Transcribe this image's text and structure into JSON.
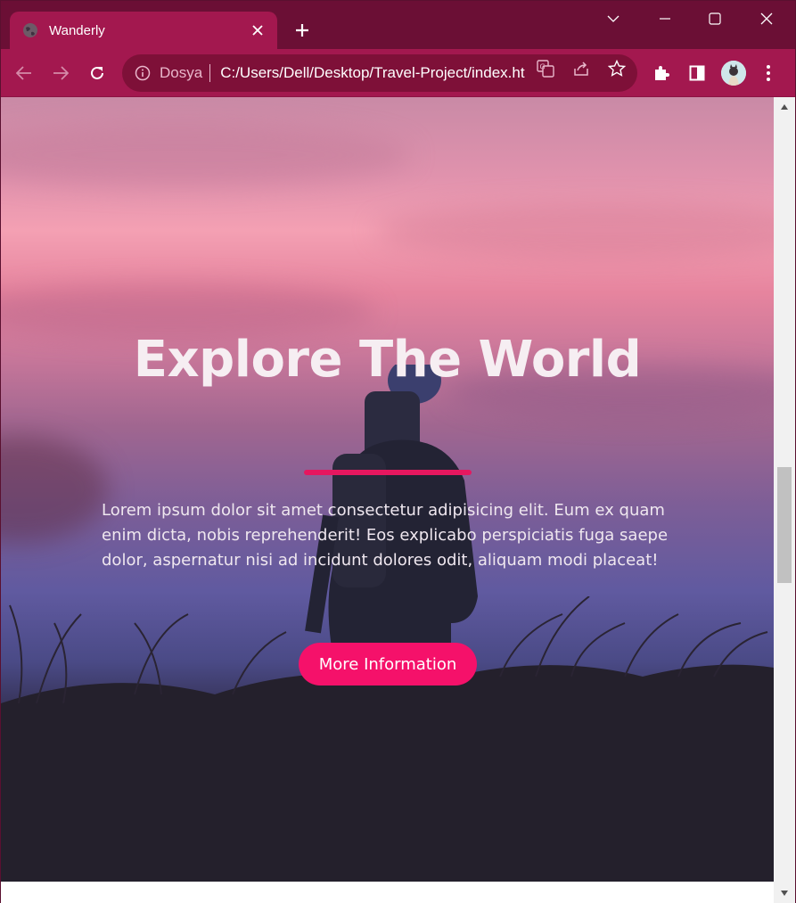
{
  "browser": {
    "tab": {
      "title": "Wanderly",
      "favicon": "globe-icon",
      "close_icon": "close-icon"
    },
    "new_tab_icon": "plus-icon",
    "window_controls": [
      "chevron-down-icon",
      "minimize-icon",
      "maximize-icon",
      "close-icon"
    ],
    "nav": {
      "back_icon": "back-arrow-icon",
      "forward_icon": "forward-arrow-icon",
      "reload_icon": "reload-icon"
    },
    "omnibox": {
      "origin_label": "Dosya",
      "url": "C:/Users/Dell/Desktop/Travel-Project/index.html",
      "icons": [
        "info-icon",
        "translate-icon",
        "share-icon",
        "star-icon"
      ]
    },
    "toolbar_icons": [
      "extensions-icon",
      "side-panel-icon",
      "profile-avatar",
      "menu-icon"
    ],
    "colors": {
      "titlebar": "#6b0f35",
      "toolbar": "#a3184f",
      "omnibox": "#7e1038"
    }
  },
  "page": {
    "hero": {
      "title": "Explore The World",
      "text": "Lorem ipsum dolor sit amet consectetur adipisicing elit. Eum ex quam enim dicta, nobis reprehenderit! Eos explicabo perspiciatis fuga saepe dolor, aspernatur nisi ad incidunt dolores odit, aliquam modi placeat!",
      "button_label": "More Information",
      "accent": "#f5116a"
    }
  }
}
